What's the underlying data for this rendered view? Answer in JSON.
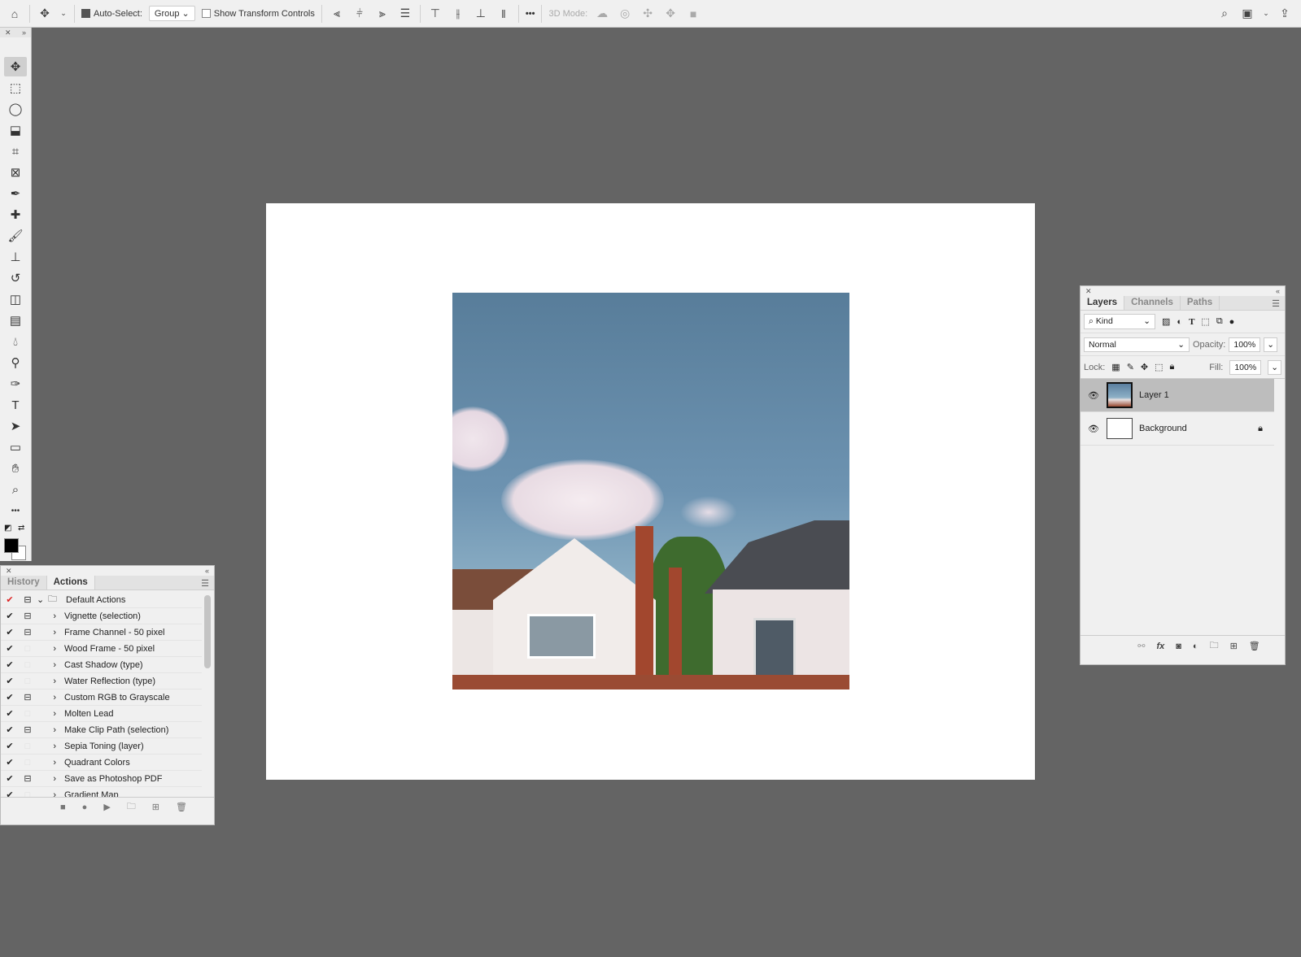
{
  "optbar": {
    "auto_select_label": "Auto-Select:",
    "auto_select_checked": true,
    "group_value": "Group",
    "show_transform_label": "Show Transform Controls",
    "show_transform_checked": false,
    "more": "•••",
    "mode_3d_label": "3D Mode:"
  },
  "tools": [
    "move",
    "rectangular-marquee",
    "lasso",
    "object-selection",
    "crop",
    "frame",
    "eyedropper",
    "healing-brush",
    "brush",
    "clone-stamp",
    "history-brush",
    "eraser",
    "gradient",
    "blur",
    "dodge",
    "pen",
    "type",
    "path-selection",
    "rectangle",
    "hand",
    "zoom",
    "more"
  ],
  "colors": {
    "foreground": "#000000",
    "background": "#ffffff"
  },
  "layers_panel": {
    "tabs": [
      "Layers",
      "Channels",
      "Paths"
    ],
    "active_tab": "Layers",
    "filter_kind": "Kind",
    "blend_mode": "Normal",
    "opacity_label": "Opacity:",
    "opacity": "100%",
    "lock_label": "Lock:",
    "fill_label": "Fill:",
    "fill": "100%",
    "layers": [
      {
        "name": "Layer 1",
        "visible": true,
        "selected": true,
        "locked": false
      },
      {
        "name": "Background",
        "visible": true,
        "selected": false,
        "locked": true
      }
    ]
  },
  "actions_panel": {
    "tabs": [
      "History",
      "Actions"
    ],
    "active_tab": "Actions",
    "set": {
      "name": "Default Actions",
      "checked": true,
      "dialog": true
    },
    "actions": [
      {
        "name": "Vignette (selection)",
        "dialog": true
      },
      {
        "name": "Frame Channel - 50 pixel",
        "dialog": true
      },
      {
        "name": "Wood Frame - 50 pixel",
        "dialog": false
      },
      {
        "name": "Cast Shadow (type)",
        "dialog": false
      },
      {
        "name": "Water Reflection (type)",
        "dialog": false
      },
      {
        "name": "Custom RGB to Grayscale",
        "dialog": true
      },
      {
        "name": "Molten Lead",
        "dialog": false
      },
      {
        "name": "Make Clip Path (selection)",
        "dialog": true
      },
      {
        "name": "Sepia Toning (layer)",
        "dialog": false
      },
      {
        "name": "Quadrant Colors",
        "dialog": false
      },
      {
        "name": "Save as Photoshop PDF",
        "dialog": true
      },
      {
        "name": "Gradient Map",
        "dialog": false
      }
    ]
  }
}
